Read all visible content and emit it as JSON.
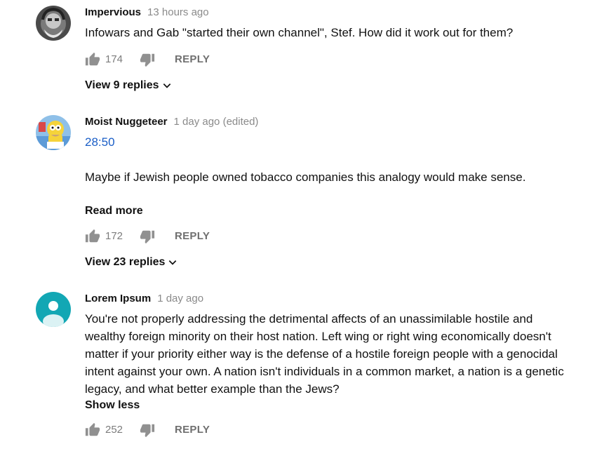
{
  "comments": [
    {
      "author": "Impervious",
      "time": "13 hours ago",
      "text": "Infowars and Gab \"started their own channel\", Stef. How did it work out for them?",
      "likes": "174",
      "reply_label": "REPLY",
      "view_replies": "View 9 replies"
    },
    {
      "author": "Moist Nuggeteer",
      "time": "1 day ago (edited)",
      "timestamp_link": "28:50",
      "text": "Maybe if Jewish people owned tobacco companies this analogy would make sense.",
      "read_more": "Read more",
      "likes": "172",
      "reply_label": "REPLY",
      "view_replies": "View 23 replies"
    },
    {
      "author": "Lorem Ipsum",
      "time": "1 day ago",
      "text": "You're not properly addressing the detrimental affects of an unassimilable hostile and wealthy foreign minority on their host nation. Left wing or right wing economically doesn't matter if your priority either way is the defense of a hostile foreign people with a genocidal intent against your own. A nation isn't individuals in a common market, a nation is a genetic legacy, and what better example than the Jews?",
      "show_less": "Show less",
      "likes": "252",
      "reply_label": "REPLY",
      "avatar_color": "#12a7b4"
    }
  ]
}
